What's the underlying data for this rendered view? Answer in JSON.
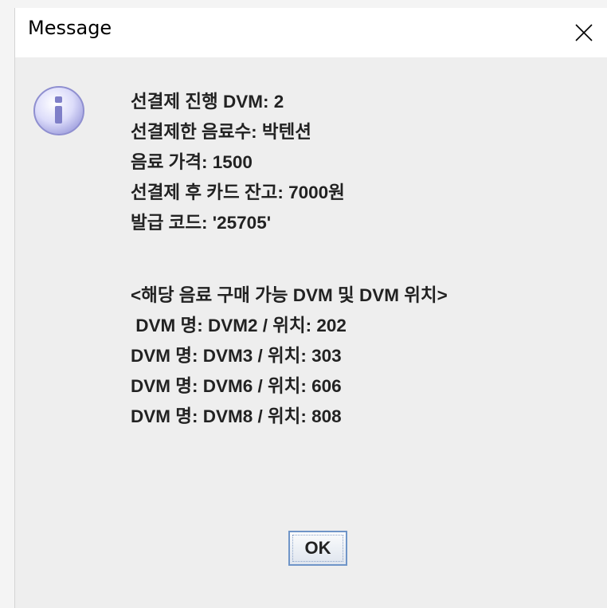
{
  "dialog": {
    "title": "Message",
    "icon": "info-icon",
    "lines": [
      "선결제 진행 DVM: 2",
      "선결제한 음료수: 박텐션",
      "음료 가격: 1500",
      "선결제 후 카드 잔고: 7000원",
      "발급 코드: '25705'"
    ],
    "section_header": "<해당 음료 구매 가능 DVM 및 DVM 위치>",
    "locations": [
      " DVM 명: DVM2 / 위치: 202",
      "DVM 명: DVM3 / 위치: 303",
      "DVM 명: DVM6 / 위치: 606",
      "DVM 명: DVM8 / 위치: 808"
    ],
    "ok_label": "OK"
  }
}
